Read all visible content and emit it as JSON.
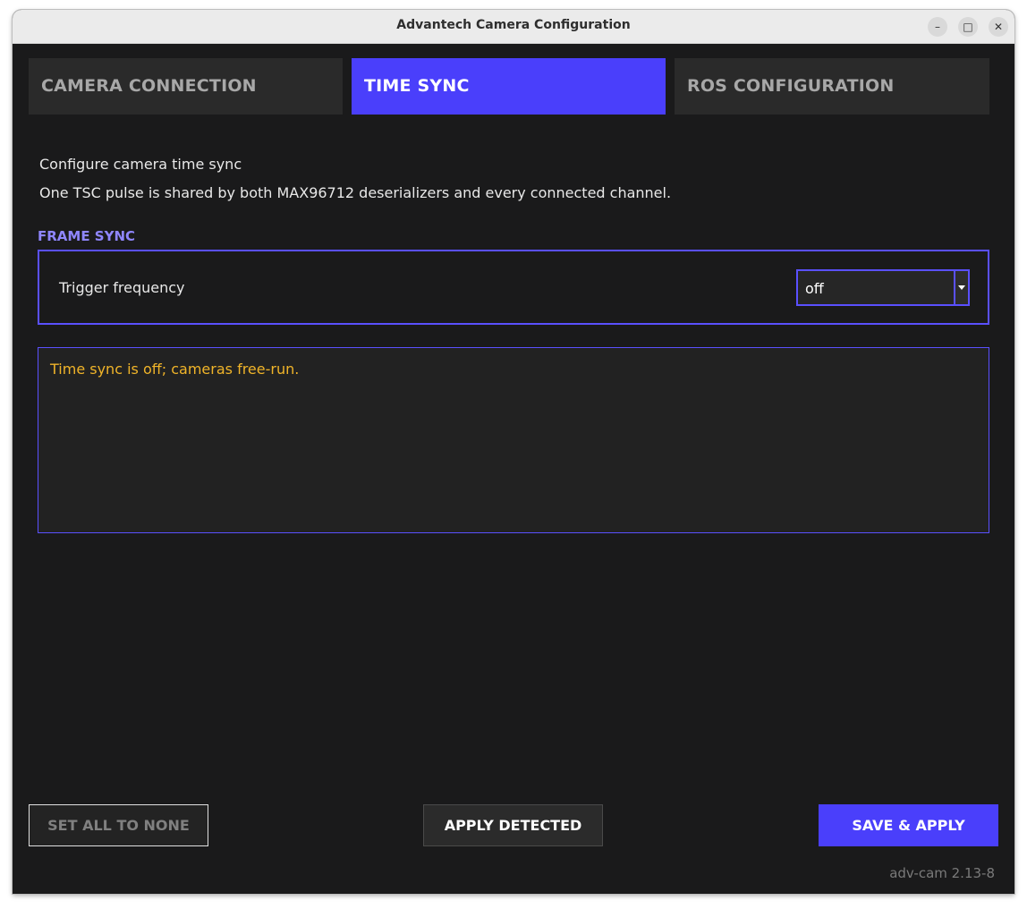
{
  "window": {
    "title": "Advantech Camera Configuration",
    "minimize_glyph": "–",
    "maximize_glyph": "□",
    "close_glyph": "✕"
  },
  "tabs": [
    {
      "label": "CAMERA CONNECTION",
      "active": false
    },
    {
      "label": "TIME SYNC",
      "active": true
    },
    {
      "label": "ROS CONFIGURATION",
      "active": false
    }
  ],
  "intro": {
    "line1": "Configure camera time sync",
    "line2": "One TSC pulse is shared by both MAX96712 deserializers and every connected channel."
  },
  "frame_sync": {
    "section_label": "FRAME SYNC",
    "trigger_label": "Trigger frequency",
    "trigger_value": "off"
  },
  "status": {
    "message": "Time sync is off; cameras free-run."
  },
  "buttons": {
    "set_all_none": "SET ALL TO NONE",
    "apply_detected": "APPLY DETECTED",
    "save_apply": "SAVE & APPLY"
  },
  "footer": {
    "version": "adv-cam 2.13-8"
  },
  "colors": {
    "accent": "#4a3ffb",
    "section_label": "#8f86ff",
    "status_warning": "#f0b429",
    "background": "#1a1a1b"
  }
}
